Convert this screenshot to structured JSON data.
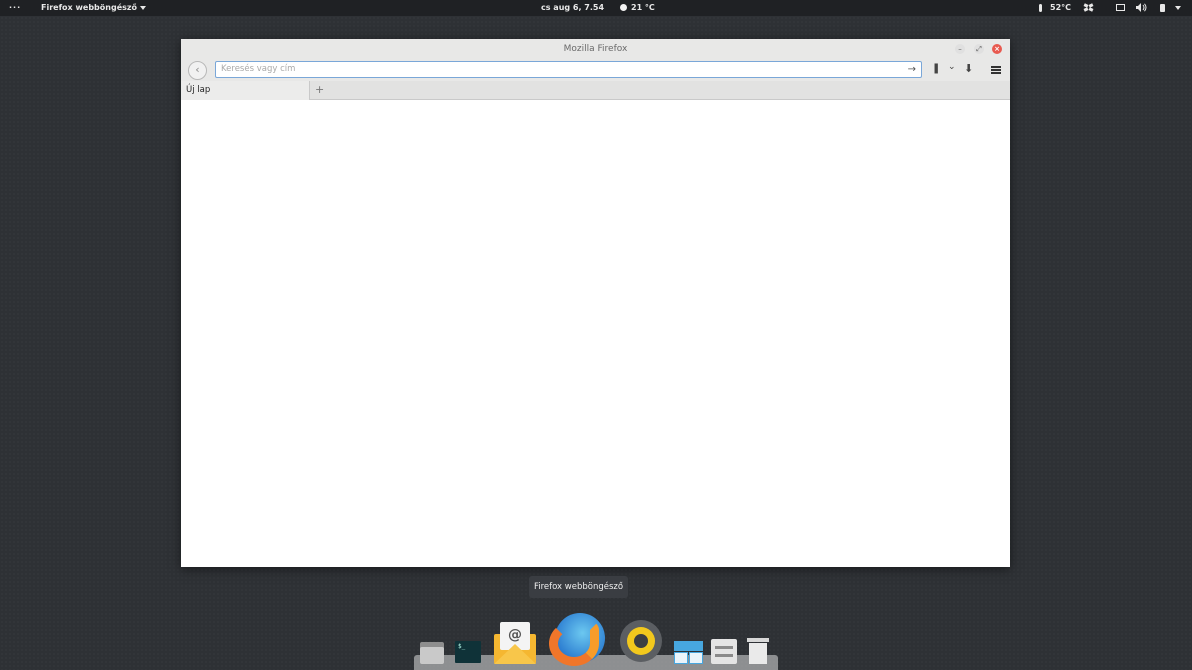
{
  "top_panel": {
    "activities_label": "···",
    "app_menu_label": "Firefox webböngésző",
    "clock": "cs aug  6,  7.54",
    "weather": "21 °C",
    "cpu_temp": "52°C"
  },
  "window": {
    "title": "Mozilla Firefox",
    "url_placeholder": "Keresés vagy cím",
    "tabs": [
      {
        "label": "Új lap"
      }
    ],
    "new_tab_label": "+"
  },
  "dock": {
    "tooltip": "Firefox webböngésző",
    "items": [
      {
        "icon": "files-icon"
      },
      {
        "icon": "terminal-icon"
      },
      {
        "icon": "mail-icon"
      },
      {
        "icon": "firefox-icon"
      },
      {
        "icon": "rhythmbox-icon"
      },
      {
        "icon": "window-manager-icon"
      },
      {
        "icon": "settings-icon"
      },
      {
        "icon": "trash-icon"
      }
    ]
  },
  "colors": {
    "desktop_background": "#2f3236",
    "panel_background": "#1f2124",
    "close_button": "#e85a50",
    "urlbar_focus_border": "#7aa7d8"
  }
}
